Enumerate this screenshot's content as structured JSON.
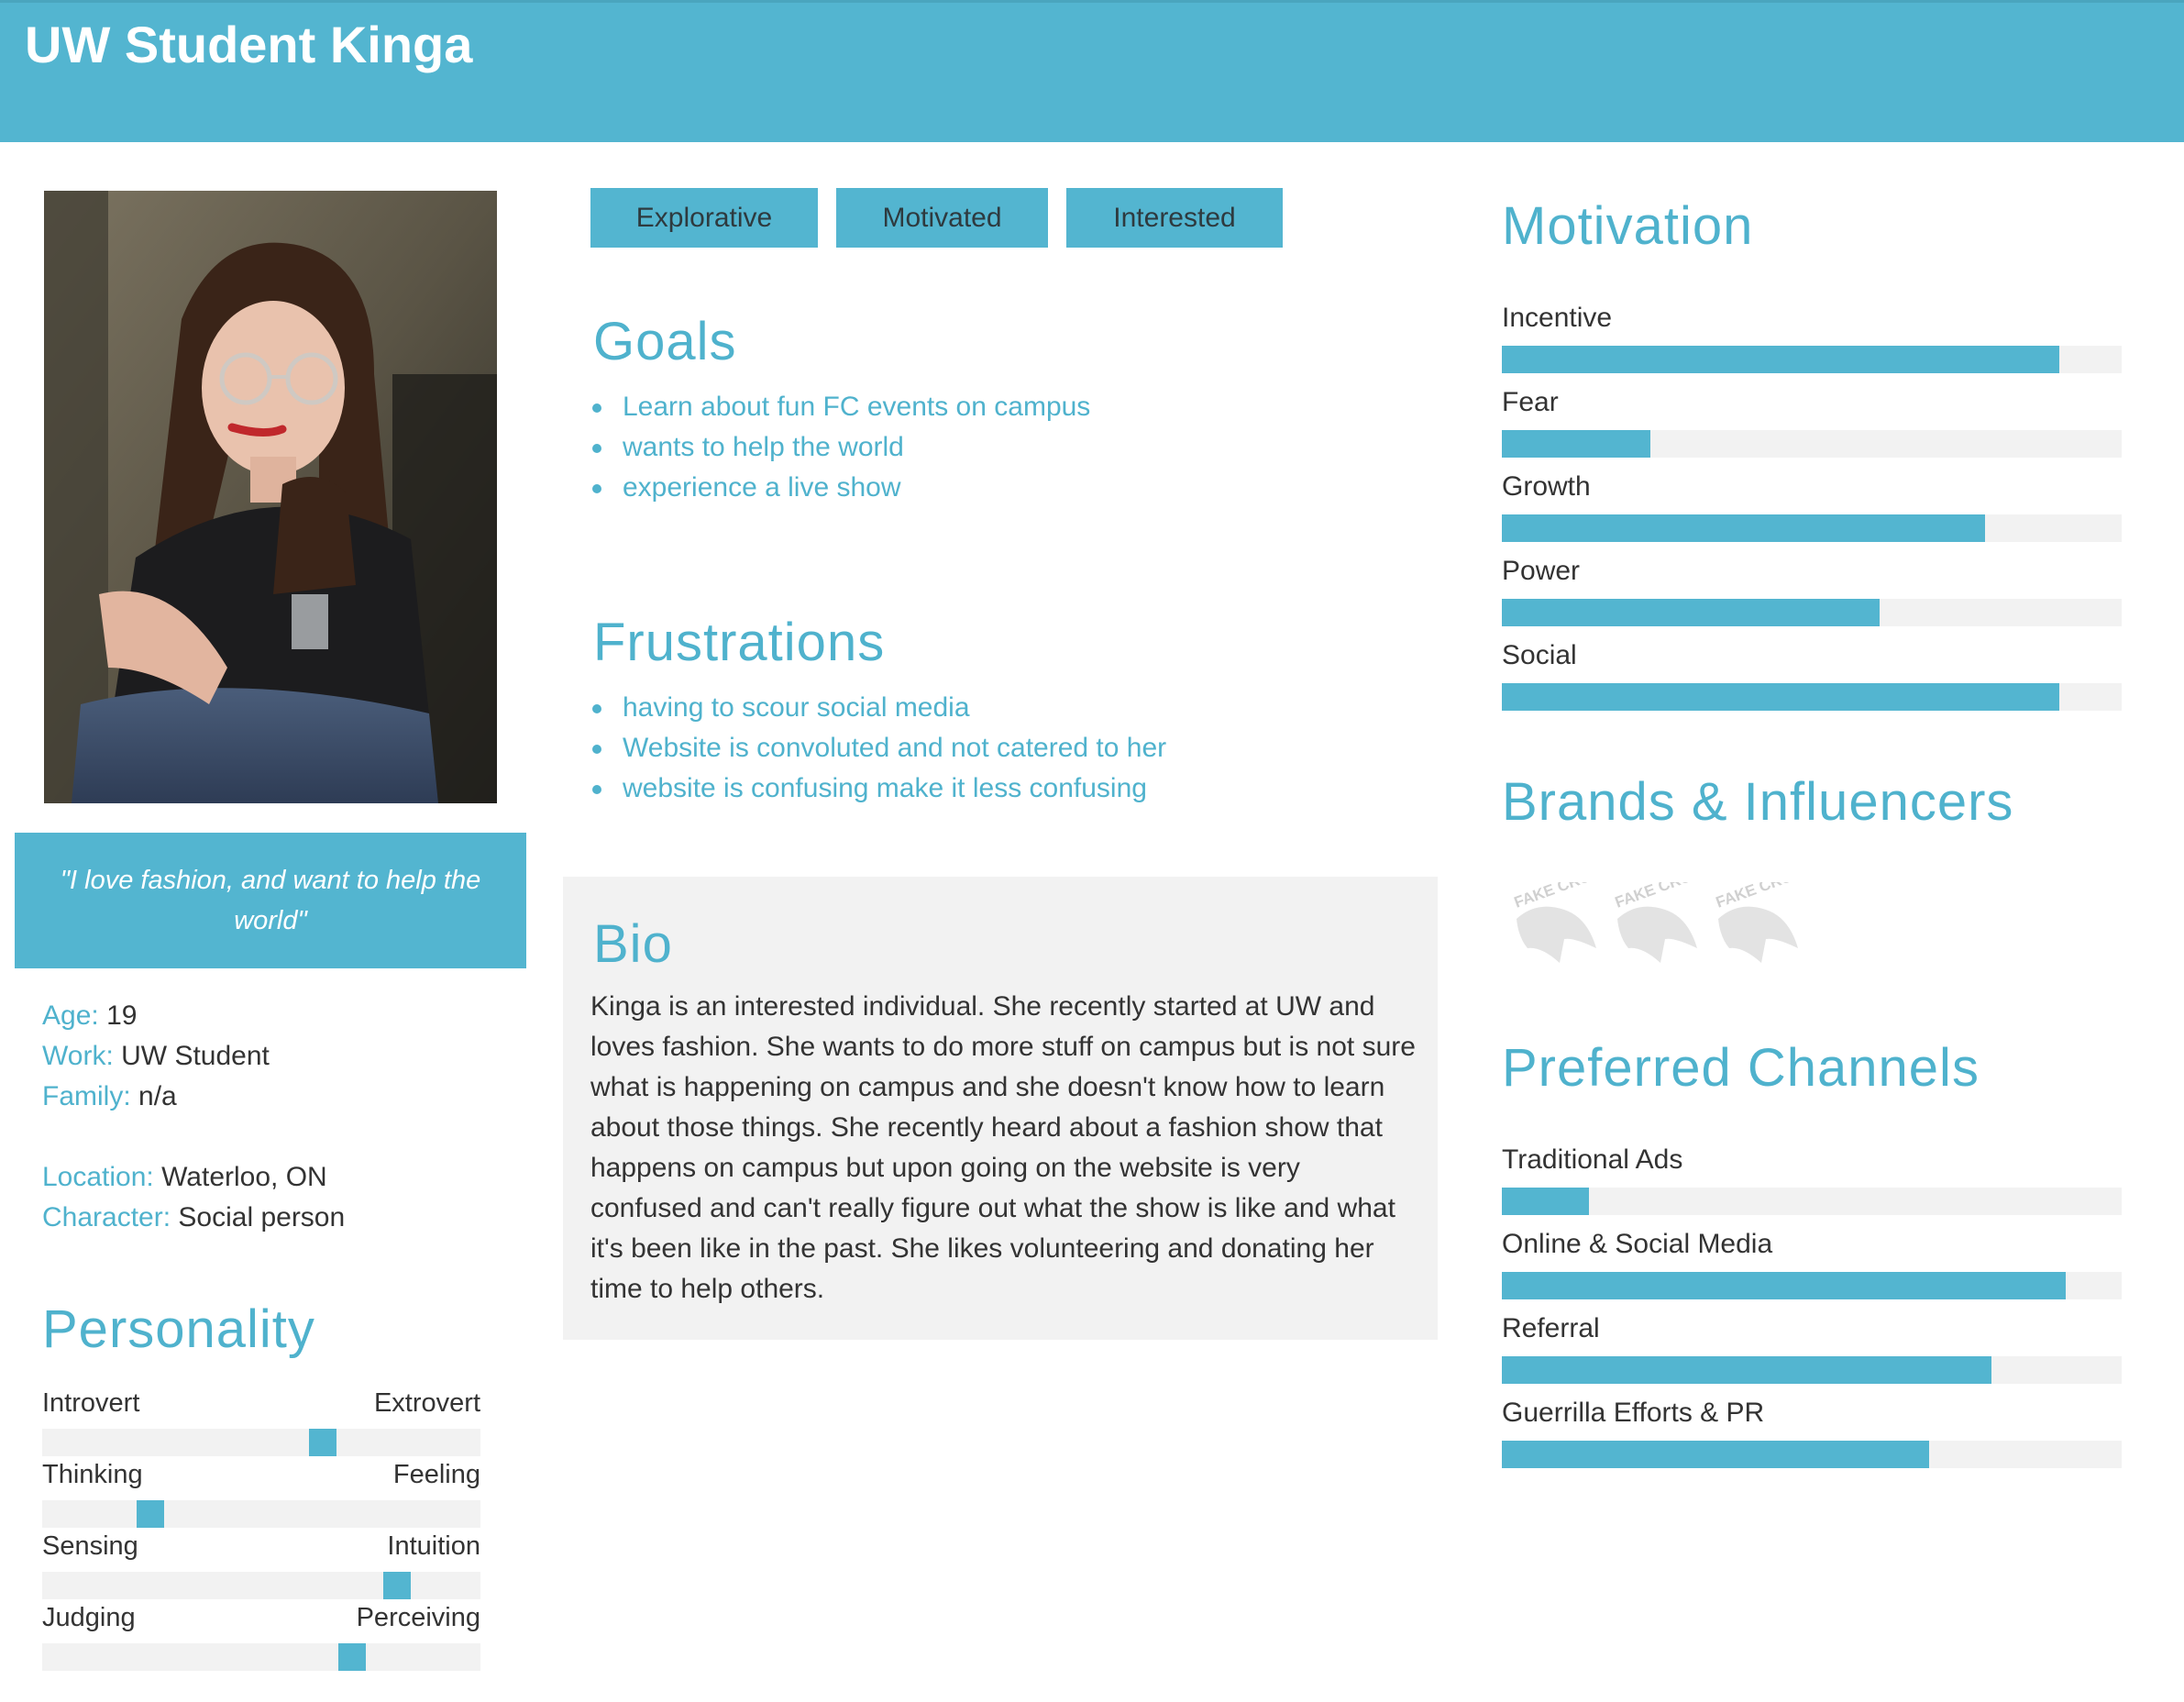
{
  "header": {
    "title": "UW Student Kinga"
  },
  "profile": {
    "quote": "\"I love fashion, and want to help the world\"",
    "details": [
      {
        "label": "Age:",
        "value": "19"
      },
      {
        "label": "Work:",
        "value": "UW Student"
      },
      {
        "label": "Family:",
        "value": "n/a"
      },
      {
        "label": "Location:",
        "value": "Waterloo, ON"
      },
      {
        "label": "Character:",
        "value": "Social person"
      }
    ]
  },
  "personality": {
    "title": "Personality",
    "traits": [
      {
        "left": "Introvert",
        "right": "Extrovert",
        "position": 0.65
      },
      {
        "left": "Thinking",
        "right": "Feeling",
        "position": 0.23
      },
      {
        "left": "Sensing",
        "right": "Intuition",
        "position": 0.83
      },
      {
        "left": "Judging",
        "right": "Perceiving",
        "position": 0.72
      }
    ]
  },
  "tags": [
    "Explorative",
    "Motivated",
    "Interested"
  ],
  "goals": {
    "title": "Goals",
    "items": [
      "Learn about fun FC events on campus",
      "wants to help the world",
      "experience a live show"
    ]
  },
  "frustrations": {
    "title": "Frustrations",
    "items": [
      "having to scour social media",
      "Website is convoluted and not catered to her",
      "website is confusing make it less confusing"
    ]
  },
  "bio": {
    "title": "Bio",
    "text": "Kinga is an interested individual. She recently started at UW and loves fashion. She wants to do more stuff on campus but is not sure what is happening on campus and she doesn't know how to learn about those things. She recently heard about a fashion show that happens on campus but upon going on the website is very confused and can't really figure out what the show is like and what it's been like in the past. She likes volunteering and donating her time to help others."
  },
  "motivation": {
    "title": "Motivation",
    "items": [
      {
        "label": "Incentive",
        "value": 0.9
      },
      {
        "label": "Fear",
        "value": 0.24
      },
      {
        "label": "Growth",
        "value": 0.78
      },
      {
        "label": "Power",
        "value": 0.61
      },
      {
        "label": "Social",
        "value": 0.9
      }
    ]
  },
  "brands": {
    "title": "Brands & Influencers",
    "logos": [
      {
        "text": "FAKE CROW",
        "icon": "fake-crow-logo"
      },
      {
        "text": "FAKE CROW",
        "icon": "fake-crow-logo"
      },
      {
        "text": "FAKE CROW",
        "icon": "fake-crow-logo"
      }
    ]
  },
  "channels": {
    "title": "Preferred Channels",
    "items": [
      {
        "label": "Traditional Ads",
        "value": 0.14
      },
      {
        "label": "Online & Social Media",
        "value": 0.91
      },
      {
        "label": "Referral",
        "value": 0.79
      },
      {
        "label": "Guerrilla Efforts & PR",
        "value": 0.69
      }
    ]
  },
  "colors": {
    "accent": "#53b5d0",
    "track": "#f2f2f2",
    "text": "#333333"
  }
}
